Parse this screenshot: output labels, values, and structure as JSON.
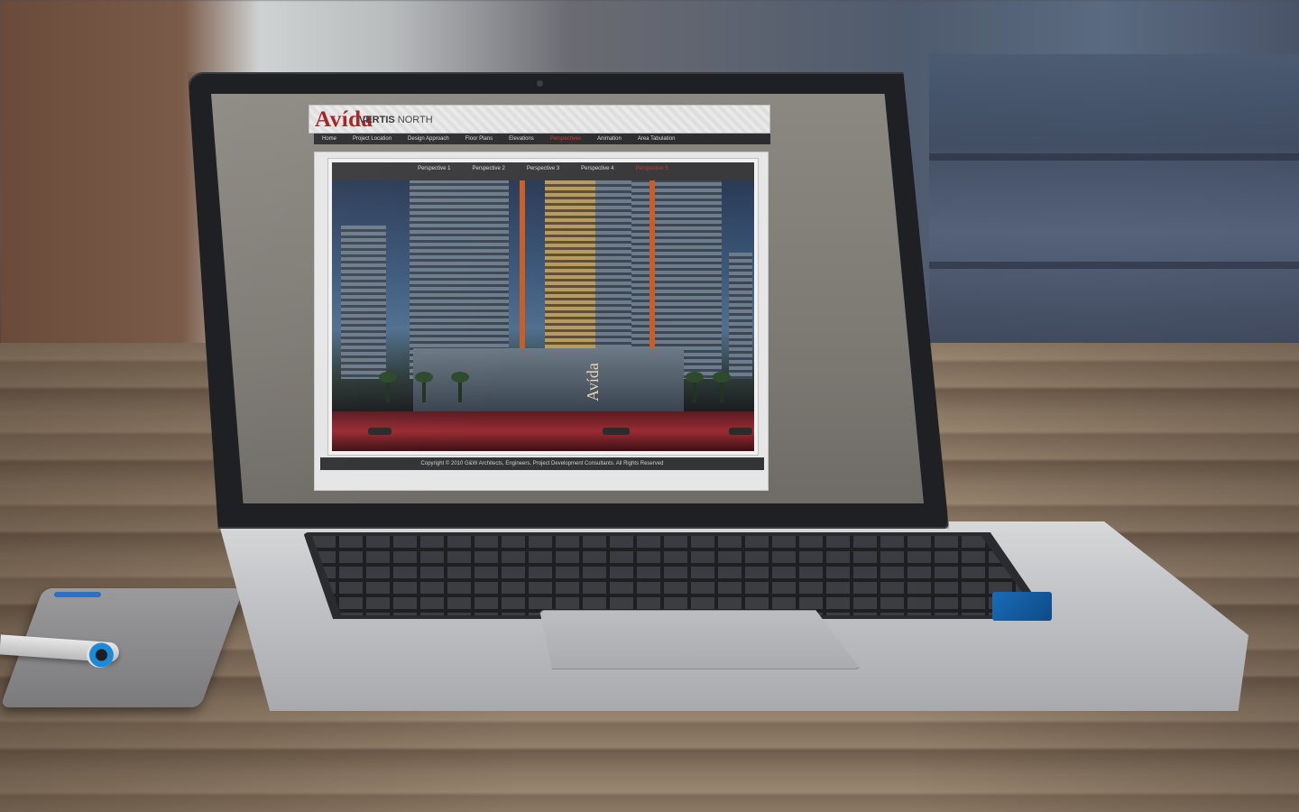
{
  "site": {
    "logo": "Avída",
    "brand_bold": "VERTIS",
    "brand_light": "NORTH",
    "nav": [
      {
        "label": "Home",
        "active": false
      },
      {
        "label": "Project Location",
        "active": false
      },
      {
        "label": "Design Approach",
        "active": false
      },
      {
        "label": "Floor Plans",
        "active": false
      },
      {
        "label": "Elevations",
        "active": false
      },
      {
        "label": "Perspectives",
        "active": true
      },
      {
        "label": "Animation",
        "active": false
      },
      {
        "label": "Area Tabulation",
        "active": false
      }
    ],
    "subnav": [
      {
        "label": "Perspective 1",
        "active": false
      },
      {
        "label": "Perspective 2",
        "active": false
      },
      {
        "label": "Perspective 3",
        "active": false
      },
      {
        "label": "Perspective 4",
        "active": false
      },
      {
        "label": "Perspective 5",
        "active": true
      }
    ],
    "render_sign": "Avída",
    "copyright": "Copyright © 2010 G&W Architects, Engineers, Project Development Consultants. All Rights Reserved"
  },
  "colors": {
    "accent": "#a31f22",
    "nav_active": "#d23b36",
    "nav_bg": "#2d2d2f"
  }
}
